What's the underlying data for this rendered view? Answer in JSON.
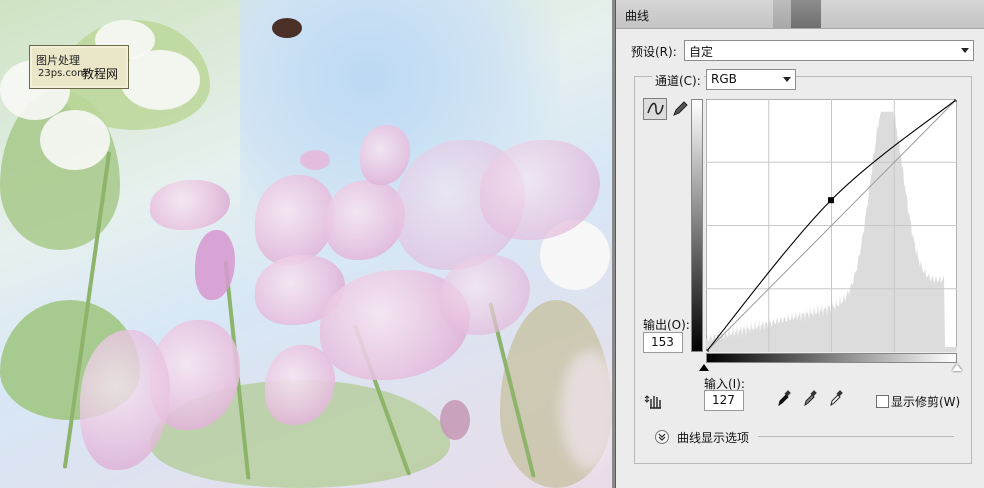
{
  "photo": {
    "watermark": {
      "line1": "图片处理",
      "line2": "23ps.com",
      "line3": "教程网"
    }
  },
  "dialog": {
    "title": "曲线",
    "preset": {
      "label": "预设(R):",
      "value": "自定"
    },
    "channel": {
      "label": "通道(C):",
      "value": "RGB"
    },
    "output": {
      "label": "输出(O):",
      "value": "153"
    },
    "input": {
      "label": "输入(I):",
      "value": "127"
    },
    "show_clipping_label": "显示修剪(W)",
    "curve_display_options_label": "曲线显示选项",
    "curve": {
      "control_points": [
        [
          0,
          0
        ],
        [
          127,
          153
        ],
        [
          255,
          255
        ]
      ]
    },
    "colors": {
      "dialog_bg": "#ececec",
      "graph_bg": "#ffffff",
      "histogram": "#dcdcdc",
      "curve": "#000000"
    },
    "icons": [
      "curve-edit-icon",
      "pencil-icon",
      "hand-adjust-icon",
      "black-eyedropper-icon",
      "gray-eyedropper-icon",
      "white-eyedropper-icon",
      "expand-chevron-icon"
    ]
  }
}
